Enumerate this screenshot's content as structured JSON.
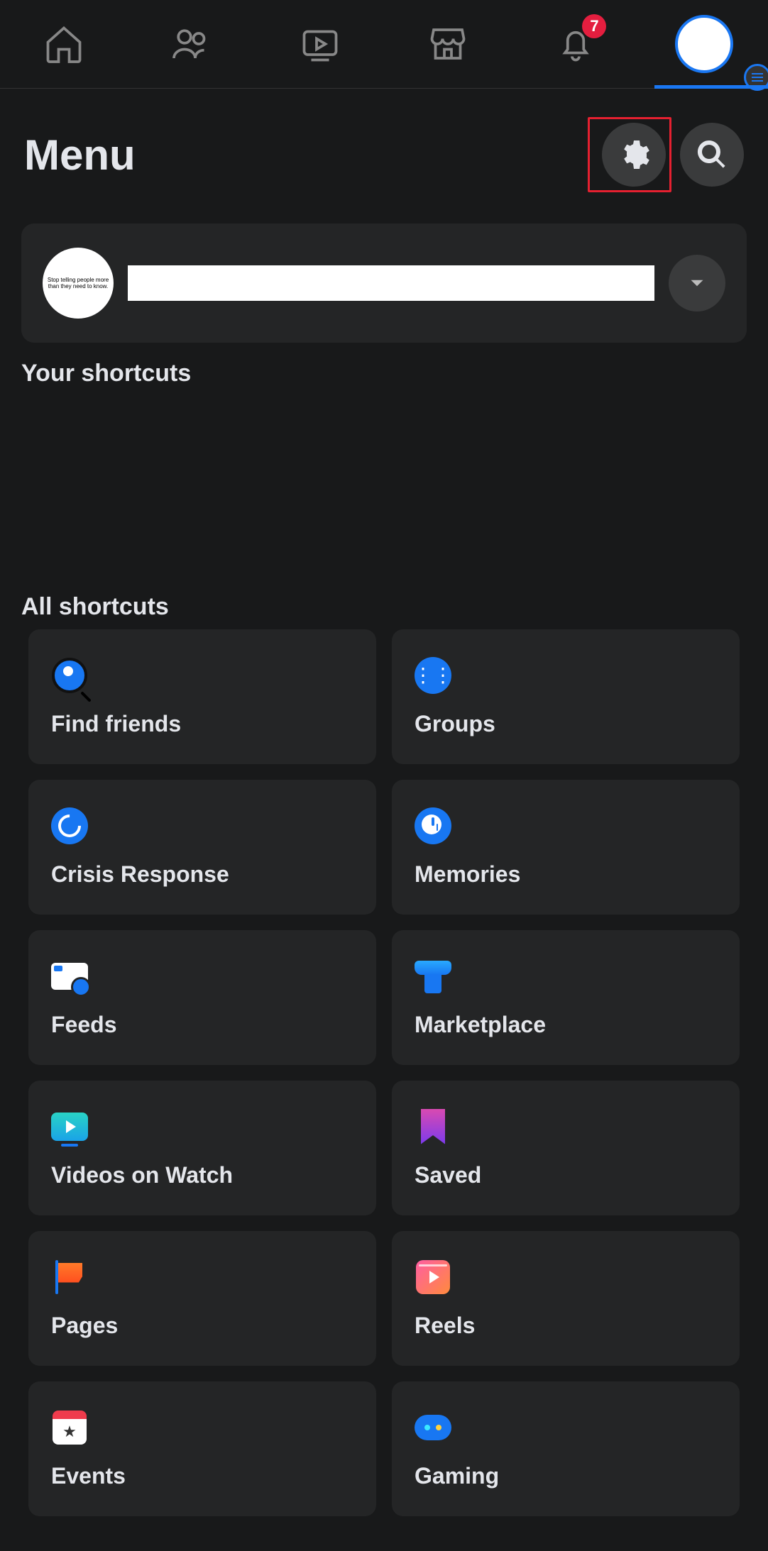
{
  "nav": {
    "notif_count": "7"
  },
  "header": {
    "title": "Menu"
  },
  "profile": {
    "name": "",
    "avatar_text": "Stop telling people more than they need to know."
  },
  "sections": {
    "shortcuts": "Your shortcuts",
    "all": "All shortcuts"
  },
  "tiles": {
    "find_friends": "Find friends",
    "groups": "Groups",
    "crisis": "Crisis Response",
    "memories": "Memories",
    "feeds": "Feeds",
    "marketplace": "Marketplace",
    "watch": "Videos on Watch",
    "saved": "Saved",
    "pages": "Pages",
    "reels": "Reels",
    "events": "Events",
    "gaming": "Gaming"
  },
  "colors": {
    "accent": "#1877f2",
    "bg": "#18191a",
    "card": "#242526",
    "badge": "#e41e3f"
  }
}
